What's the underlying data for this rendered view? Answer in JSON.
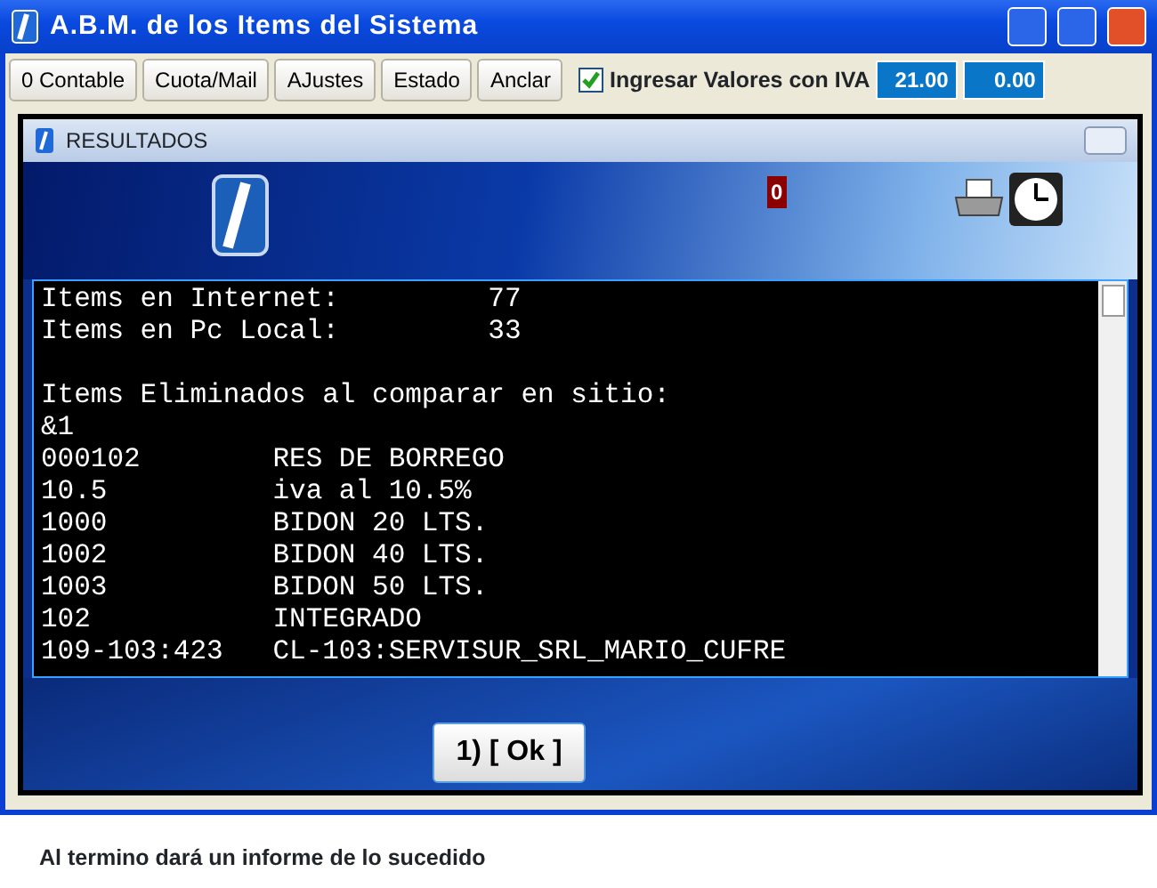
{
  "window": {
    "title": "A.B.M. de los Items del Sistema"
  },
  "toolbar": {
    "buttons": [
      "0 Contable",
      "Cuota/Mail",
      "AJustes",
      "Estado",
      "Anclar"
    ],
    "checkbox": {
      "label": "Ingresar Valores con IVA",
      "checked": true
    },
    "values": [
      "21.00",
      "0.00"
    ]
  },
  "dialog": {
    "title": "RESULTADOS",
    "badge": "0",
    "lines": [
      {
        "kind": "text",
        "text": "Items en Internet:         77"
      },
      {
        "kind": "text",
        "text": "Items en Pc Local:         33"
      },
      {
        "kind": "blank"
      },
      {
        "kind": "text",
        "text": "Items Eliminados al comparar en sitio:"
      },
      {
        "kind": "text",
        "text": "&1"
      },
      {
        "kind": "text",
        "text": "000102        RES DE BORREGO"
      },
      {
        "kind": "text",
        "text": "10.5          iva al 10.5%"
      },
      {
        "kind": "text",
        "text": "1000          BIDON 20 LTS."
      },
      {
        "kind": "text",
        "text": "1002          BIDON 40 LTS."
      },
      {
        "kind": "text",
        "text": "1003          BIDON 50 LTS."
      },
      {
        "kind": "text",
        "text": "102           INTEGRADO"
      },
      {
        "kind": "text",
        "text": "109-103:423   CL-103:SERVISUR_SRL_MARIO_CUFRE"
      }
    ],
    "ok_button": "1) [ Ok ]"
  },
  "caption": "Al termino dará un informe de lo sucedido"
}
